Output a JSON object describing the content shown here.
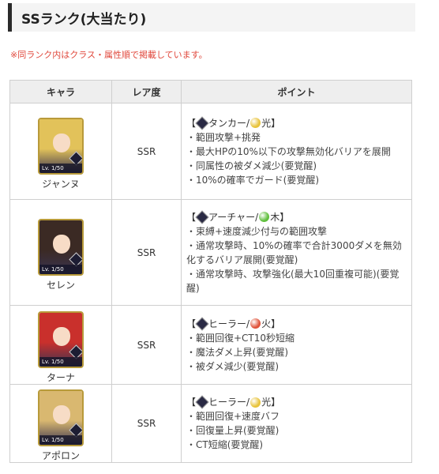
{
  "heading": "SSランク(大当たり)",
  "note": "※同ランク内はクラス・属性順で掲載しています。",
  "table": {
    "headers": [
      "キャラ",
      "レア度",
      "ポイント"
    ],
    "rows": [
      {
        "name": "ジャンヌ",
        "level": "Lv. 1/50",
        "rarity": "SSR",
        "type_prefix": "【",
        "type_label": "タンカー/",
        "attr_label": "光】",
        "attr_color": "#e8c33a",
        "hair_color": "#e2c25a",
        "points": [
          "・範囲攻撃+挑発",
          "・最大HPの10%以下の攻撃無効化バリアを展開",
          "・同属性の被ダメ減少(要覚醒)",
          "・10%の確率でガード(要覚醒)"
        ]
      },
      {
        "name": "セレン",
        "level": "Lv. 1/50",
        "rarity": "SSR",
        "type_prefix": "【",
        "type_label": "アーチャー/",
        "attr_label": "木】",
        "attr_color": "#5fbf3c",
        "hair_color": "#3b2a24",
        "points": [
          "・束縛+速度減少付与の範囲攻撃",
          "・通常攻撃時、10%の確率で合計3000ダメを無効化するバリア展開(要覚醒)",
          "・通常攻撃時、攻撃強化(最大10回重複可能)(要覚醒)"
        ]
      },
      {
        "name": "ターナ",
        "level": "Lv. 1/50",
        "rarity": "SSR",
        "type_prefix": "【",
        "type_label": "ヒーラー/",
        "attr_label": "火】",
        "attr_color": "#e0533a",
        "hair_color": "#c9302c",
        "points": [
          "・範囲回復+CT10秒短縮",
          "・魔法ダメ上昇(要覚醒)",
          "・被ダメ減少(要覚醒)"
        ]
      },
      {
        "name": "アポロン",
        "level": "Lv. 1/50",
        "rarity": "SSR",
        "type_prefix": "【",
        "type_label": "ヒーラー/",
        "attr_label": "光】",
        "attr_color": "#e8c33a",
        "hair_color": "#d9b870",
        "points": [
          "・範囲回復+速度バフ",
          "・回復量上昇(要覚醒)",
          "・CT短縮(要覚醒)"
        ]
      }
    ]
  }
}
